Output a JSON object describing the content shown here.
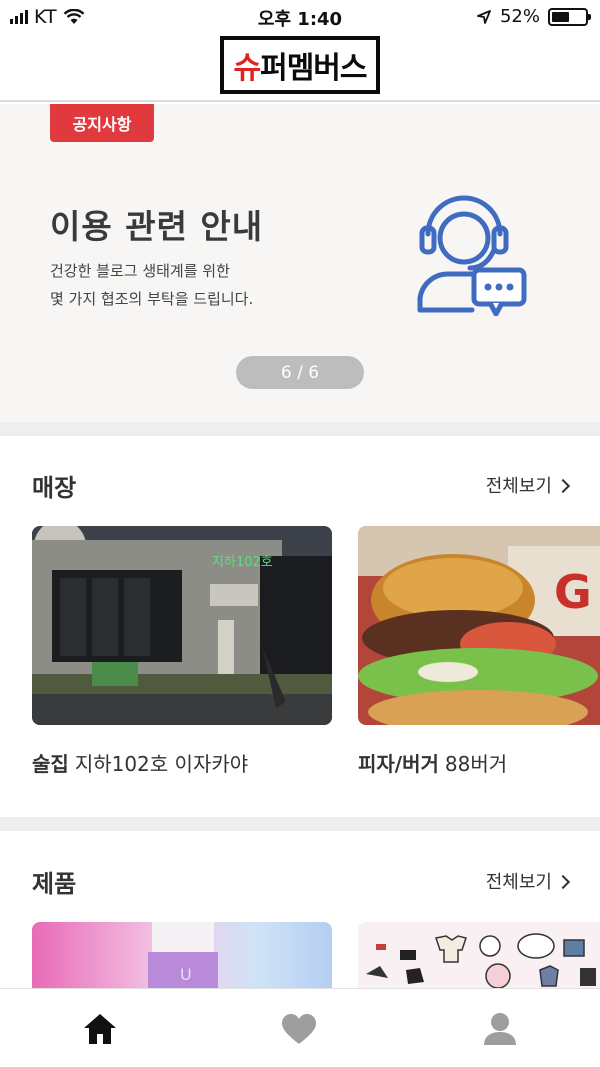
{
  "status_bar": {
    "carrier": "KT",
    "time": "오후 1:40",
    "battery": "52%",
    "battery_level": 0.52,
    "icons": [
      "signal-icon",
      "wifi-icon",
      "location-arrow-icon",
      "battery-icon"
    ]
  },
  "header": {
    "logo_text": "슈퍼멤버스",
    "logo_colors": {
      "accent": "#e0231f",
      "ink": "#0b0b0b"
    }
  },
  "banner": {
    "badge": "공지사항",
    "title": "이용 관련 안내",
    "desc_line1": "건강한 블로그 생태계를 위한",
    "desc_line2": "몇 가지 협조의 부탁을 드립니다.",
    "pager": "6 / 6",
    "icon": "customer-support-icon",
    "colors": {
      "badge": "#e0393e",
      "icon": "#3f6cc0"
    }
  },
  "stores": {
    "title": "매장",
    "see_all": "전체보기",
    "items": [
      {
        "category": "술집",
        "name": "지하102호 이자카야",
        "image": "izakaya-storefront-photo"
      },
      {
        "category": "피자/버거",
        "name": "88버거",
        "image": "burger-photo"
      }
    ]
  },
  "products": {
    "title": "제품",
    "see_all": "전체보기",
    "items": [
      {
        "image": "cosmetic-product-photo"
      },
      {
        "image": "fashion-illustration-photo"
      }
    ]
  },
  "bottom_nav": {
    "items": [
      {
        "icon": "home-icon",
        "active": true
      },
      {
        "icon": "heart-icon",
        "active": false
      },
      {
        "icon": "user-icon",
        "active": false
      }
    ]
  }
}
